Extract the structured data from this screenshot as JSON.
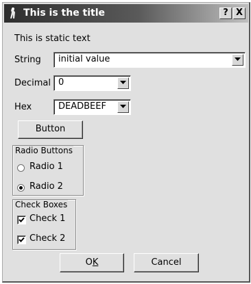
{
  "window": {
    "title": "This is the title",
    "help_label": "?",
    "close_label": "X"
  },
  "static_text": "This is static text",
  "string_field": {
    "label": "String",
    "value": "initial value"
  },
  "decimal_field": {
    "label": "Decimal",
    "value": "0"
  },
  "hex_field": {
    "label": "Hex",
    "value": "DEADBEEF"
  },
  "button": {
    "label": "Button"
  },
  "radio_group": {
    "label": "Radio Buttons",
    "options": [
      {
        "label": "Radio 1",
        "selected": false
      },
      {
        "label": "Radio 2",
        "selected": true
      }
    ]
  },
  "check_group": {
    "label": "Check Boxes",
    "options": [
      {
        "label": "Check 1",
        "checked": true
      },
      {
        "label": "Check 2",
        "checked": true
      }
    ]
  },
  "footer": {
    "ok_label": "OK",
    "ok_mnemonic": "K",
    "cancel_label": "Cancel"
  }
}
